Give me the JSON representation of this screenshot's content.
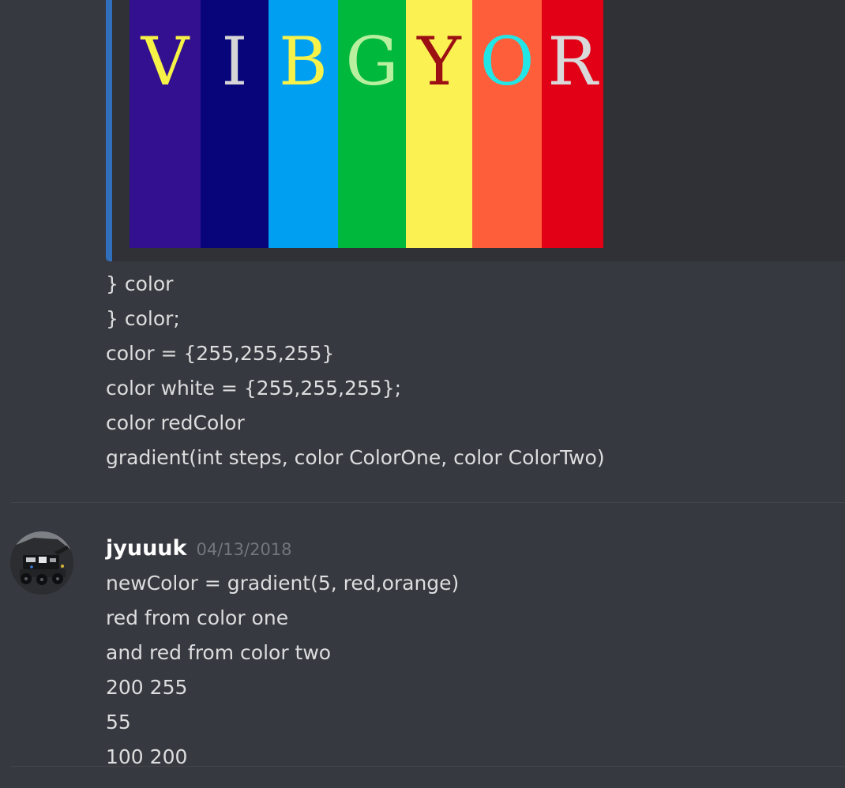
{
  "embed": {
    "accent_color": "#2f6fbb",
    "stripes": [
      {
        "letter": "V",
        "bg": "#33108f",
        "fg": "#f7f246"
      },
      {
        "letter": "I",
        "bg": "#08057a",
        "fg": "#d6d6d6"
      },
      {
        "letter": "B",
        "bg": "#009ff2",
        "fg": "#f6f24a"
      },
      {
        "letter": "G",
        "bg": "#00b83c",
        "fg": "#b8f0a0"
      },
      {
        "letter": "Y",
        "bg": "#fbf153",
        "fg": "#9c1014"
      },
      {
        "letter": "O",
        "bg": "#ff5e3b",
        "fg": "#22e6e6"
      },
      {
        "letter": "R",
        "bg": "#e20016",
        "fg": "#d9d9d9"
      }
    ]
  },
  "message1": {
    "lines": [
      "} color",
      "} color;",
      "color = {255,255,255}",
      "color white = {255,255,255};",
      "color redColor",
      "gradient(int steps, color ColorOne, color ColorTwo)"
    ]
  },
  "message2": {
    "username": "jyuuuk",
    "timestamp": "04/13/2018",
    "lines": [
      "newColor = gradient(5, red,orange)",
      "red from color one",
      "and red from color two",
      "200 255",
      "55",
      "100 200"
    ]
  }
}
